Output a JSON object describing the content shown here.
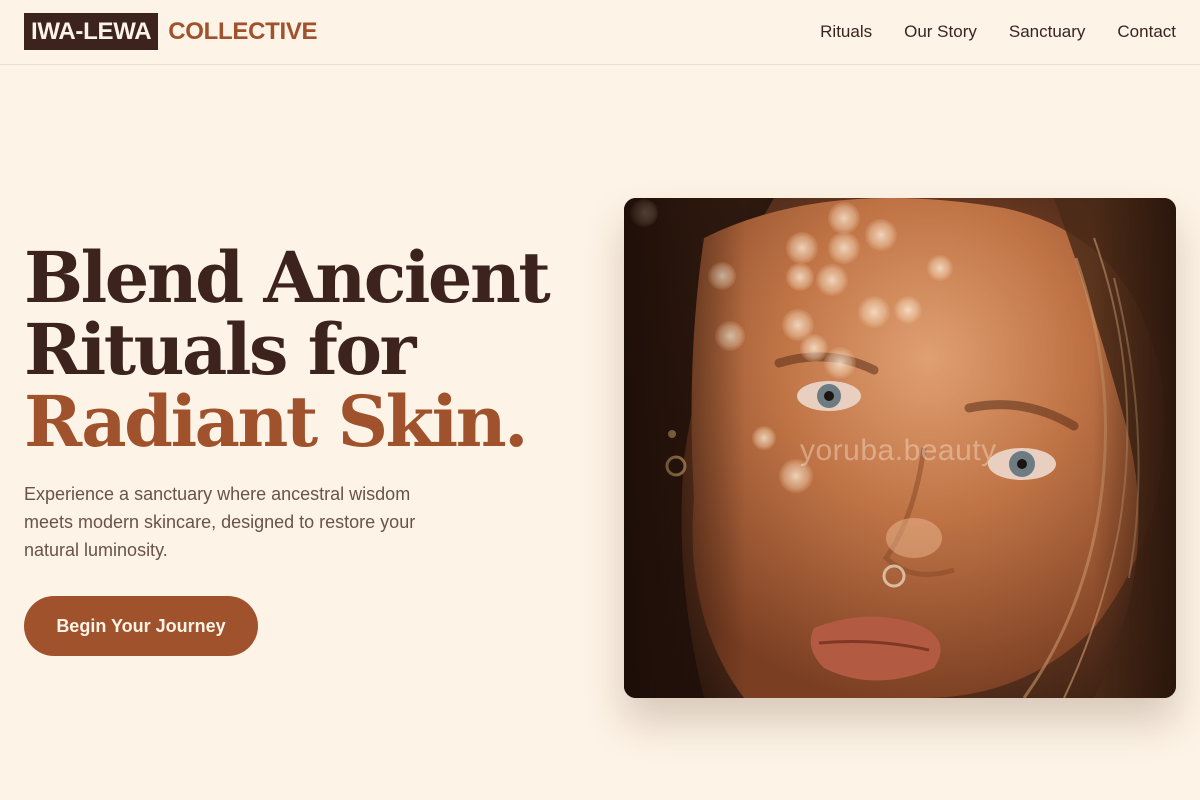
{
  "header": {
    "logo_main": "IWA-LEWA",
    "logo_sub": "COLLECTIVE",
    "nav": [
      "Rituals",
      "Our Story",
      "Sanctuary",
      "Contact"
    ]
  },
  "hero": {
    "title_line1": "Blend Ancient",
    "title_line2": "Rituals for",
    "title_line3": "Radiant Skin.",
    "description": "Experience a sanctuary where ancestral wisdom meets modern skincare, designed to restore your natural luminosity.",
    "cta_label": "Begin Your Journey",
    "image_watermark": "yoruba.beauty"
  },
  "colors": {
    "background": "#fdf3e6",
    "dark_brown": "#3d231d",
    "accent": "#a0522d"
  }
}
